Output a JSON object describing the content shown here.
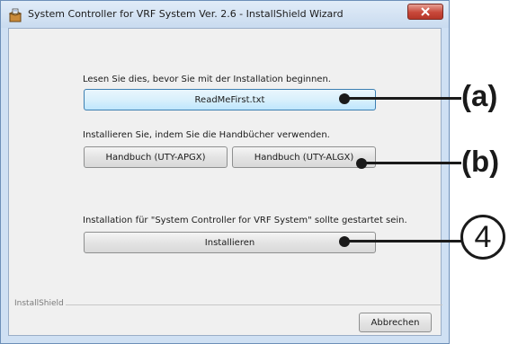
{
  "window": {
    "title": "System Controller for VRF System Ver. 2.6 - InstallShield Wizard",
    "close_label": "×"
  },
  "readme_section": {
    "label": "Lesen Sie dies, bevor Sie mit der Installation beginnen.",
    "button": "ReadMeFirst.txt"
  },
  "manual_section": {
    "label": "Installieren Sie, indem Sie die Handbücher verwenden.",
    "button_apgx": "Handbuch (UTY-APGX)",
    "button_algx": "Handbuch (UTY-ALGX)"
  },
  "install_section": {
    "label": "Installation für \"System Controller for VRF System\" sollte gestartet sein.",
    "button": "Installieren"
  },
  "footer": {
    "group_label": "InstallShield",
    "cancel_button": "Abbrechen"
  },
  "callouts": {
    "a": "(a)",
    "b": "(b)",
    "four": "4"
  },
  "colors": {
    "callout": "#1a1a1a",
    "primary_border": "#3c7fb1"
  },
  "icons": {
    "app": "installer-box-icon",
    "close": "close-icon"
  }
}
